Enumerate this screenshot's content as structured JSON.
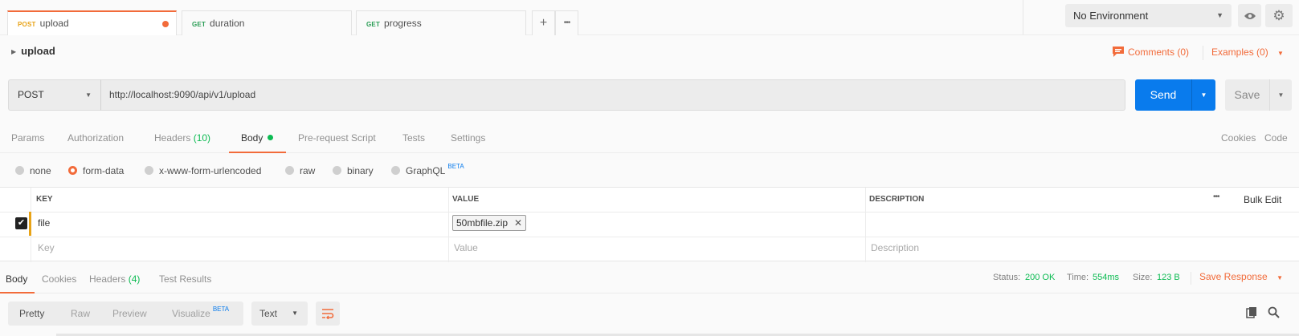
{
  "tabs": [
    {
      "method": "POST",
      "name": "upload",
      "unsaved": true
    },
    {
      "method": "GET",
      "name": "duration"
    },
    {
      "method": "GET",
      "name": "progress"
    }
  ],
  "tabstrip": {
    "add_label": "+",
    "more_label": "•••"
  },
  "environment": {
    "selected": "No Environment"
  },
  "request": {
    "name": "upload",
    "comments_label": "Comments (0)",
    "examples_label": "Examples (0)",
    "method": "POST",
    "url": "http://localhost:9090/api/v1/upload",
    "send_label": "Send",
    "save_label": "Save"
  },
  "request_tabs": {
    "params": "Params",
    "authorization": "Authorization",
    "headers": "Headers",
    "headers_count": "(10)",
    "body": "Body",
    "prerequest": "Pre-request Script",
    "tests": "Tests",
    "settings": "Settings",
    "cookies": "Cookies",
    "code": "Code"
  },
  "body_types": {
    "none": "none",
    "form_data": "form-data",
    "urlencoded": "x-www-form-urlencoded",
    "raw": "raw",
    "binary": "binary",
    "graphql": "GraphQL",
    "beta": "BETA",
    "selected": "form-data"
  },
  "kv_table": {
    "headers": {
      "key": "KEY",
      "value": "VALUE",
      "description": "DESCRIPTION"
    },
    "more_label": "•••",
    "bulk_edit": "Bulk Edit",
    "rows": [
      {
        "checked": true,
        "key": "file",
        "file": "50mbfile.zip",
        "description": ""
      }
    ],
    "placeholders": {
      "key": "Key",
      "value": "Value",
      "description": "Description"
    }
  },
  "response": {
    "tabs": {
      "body": "Body",
      "cookies": "Cookies",
      "headers": "Headers",
      "headers_count": "(4)",
      "test_results": "Test Results"
    },
    "status_label": "Status:",
    "status_value": "200 OK",
    "time_label": "Time:",
    "time_value": "554ms",
    "size_label": "Size:",
    "size_value": "123 B",
    "save_response": "Save Response",
    "views": {
      "pretty": "Pretty",
      "raw": "Raw",
      "preview": "Preview",
      "visualize": "Visualize",
      "beta": "BETA"
    },
    "format": "Text"
  },
  "colors": {
    "accent": "#f26b3a",
    "primary": "#097bed",
    "success": "#0cbb52",
    "post": "#e8a317",
    "get": "#2a9d55"
  },
  "icons": [
    "caret-right-icon",
    "comment-icon",
    "chevron-down-icon",
    "eye-icon",
    "gear-icon",
    "plus-icon",
    "more-icon",
    "check-icon",
    "close-icon",
    "wrap-lines-icon",
    "copy-icon",
    "search-icon"
  ]
}
